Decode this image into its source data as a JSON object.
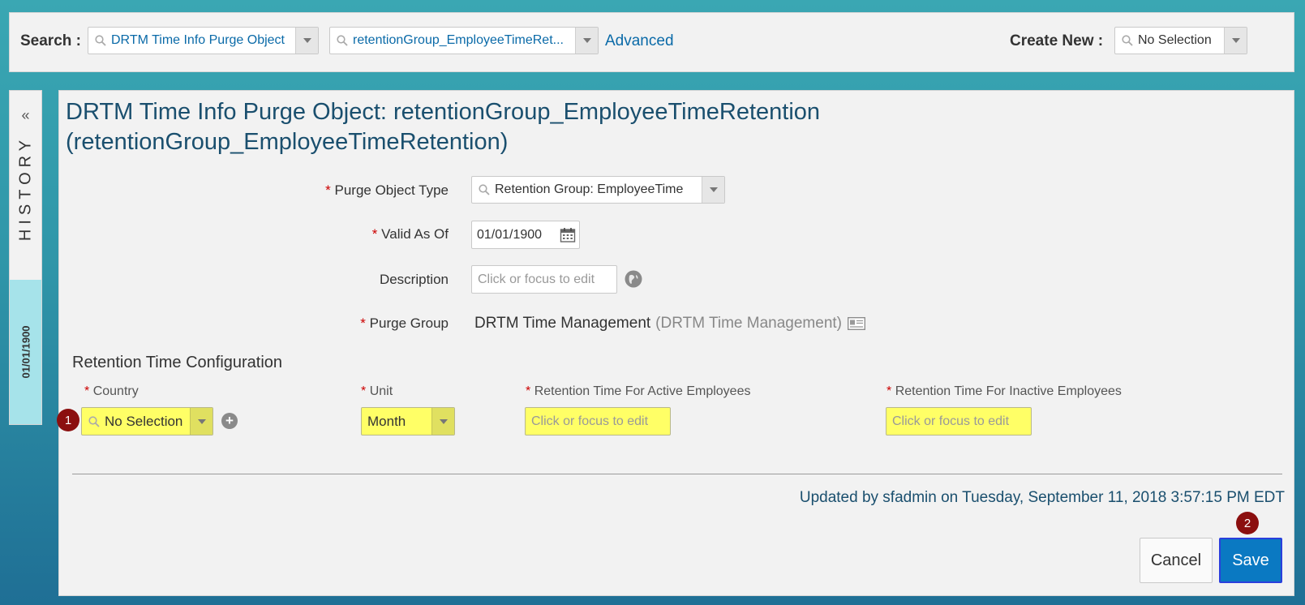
{
  "search": {
    "label": "Search :",
    "object_value": "DRTM Time Info Purge Object",
    "record_value": "retentionGroup_EmployeeTimeRet...",
    "advanced_link": "Advanced",
    "create_new_label": "Create New :",
    "create_new_value": "No Selection"
  },
  "history": {
    "collapse_glyph": "«",
    "label": "HISTORY",
    "date": "01/01/1900"
  },
  "page": {
    "title_line1": "DRTM Time Info Purge Object: retentionGroup_EmployeeTimeRetention",
    "title_line2": "(retentionGroup_EmployeeTimeRetention)"
  },
  "form": {
    "required_mark": "*",
    "purge_object_type_label": "Purge Object Type",
    "purge_object_type_value": "Retention Group: EmployeeTime",
    "valid_as_of_label": "Valid As Of",
    "valid_as_of_value": "01/01/1900",
    "description_label": "Description",
    "description_placeholder": "Click or focus to edit",
    "purge_group_label": "Purge Group",
    "purge_group_value": "DRTM Time Management",
    "purge_group_secondary": "(DRTM Time Management)"
  },
  "retention": {
    "section_title": "Retention Time Configuration",
    "col_country": "Country",
    "col_unit": "Unit",
    "col_active": "Retention Time For Active Employees",
    "col_inactive": "Retention Time For Inactive Employees",
    "country_value": "No Selection",
    "unit_value": "Month",
    "active_placeholder": "Click or focus to edit",
    "inactive_placeholder": "Click or focus to edit"
  },
  "footer": {
    "updated_text": "Updated by sfadmin on Tuesday, September 11, 2018 3:57:15 PM EDT",
    "cancel_label": "Cancel",
    "save_label": "Save"
  },
  "badges": {
    "step1": "1",
    "step2": "2"
  },
  "colors": {
    "highlight": "#ffff66",
    "badge": "#8b0f0f",
    "save_button": "#0a79c2",
    "link": "#0a6aa8",
    "title": "#1a4f6e"
  }
}
